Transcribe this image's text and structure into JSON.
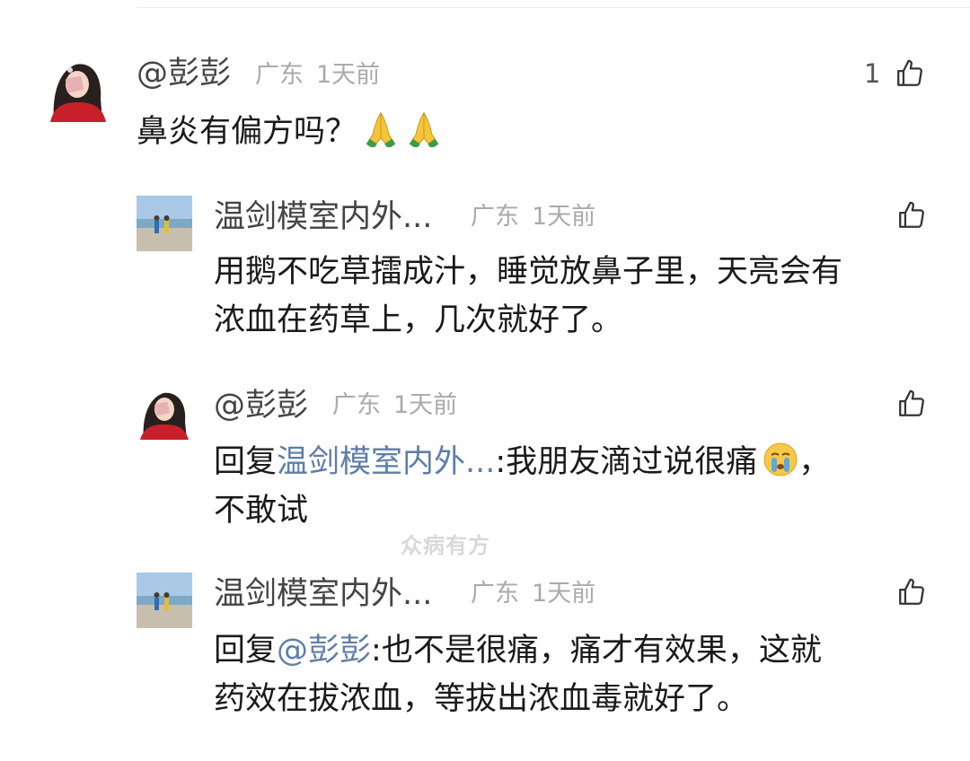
{
  "comments": [
    {
      "user": "@彭彭",
      "location": "广东",
      "time": "1天前",
      "likes": "1",
      "text": "鼻炎有偏方吗？",
      "emojis": [
        "folded-hands",
        "folded-hands"
      ]
    },
    {
      "user": "温剑模室内外...",
      "location": "广东",
      "time": "1天前",
      "text_line1": "用鹅不吃草擂成汁，睡觉放鼻子里，天亮会有",
      "text_line2": "浓血在药草上，几次就好了。"
    },
    {
      "user": "@彭彭",
      "location": "广东",
      "time": "1天前",
      "reply_prefix": "回复",
      "reply_target": "温剑模室内外...",
      "text_a": ":我朋友滴过说很痛",
      "text_b": "，",
      "text_line2": "不敢试",
      "emoji": "crying-face"
    },
    {
      "user": "温剑模室内外...",
      "location": "广东",
      "time": "1天前",
      "reply_prefix": "回复",
      "reply_target": "@彭彭",
      "text_line1": ":也不是很痛，痛才有效果，这就",
      "text_line2": "药效在拔浓血，等拔出浓血毒就好了。"
    }
  ],
  "watermark": "众病有方",
  "colors": {
    "name": "#444444",
    "meta": "#aaaaaa",
    "link": "#5e7ea8",
    "text": "#1a1a1a"
  }
}
